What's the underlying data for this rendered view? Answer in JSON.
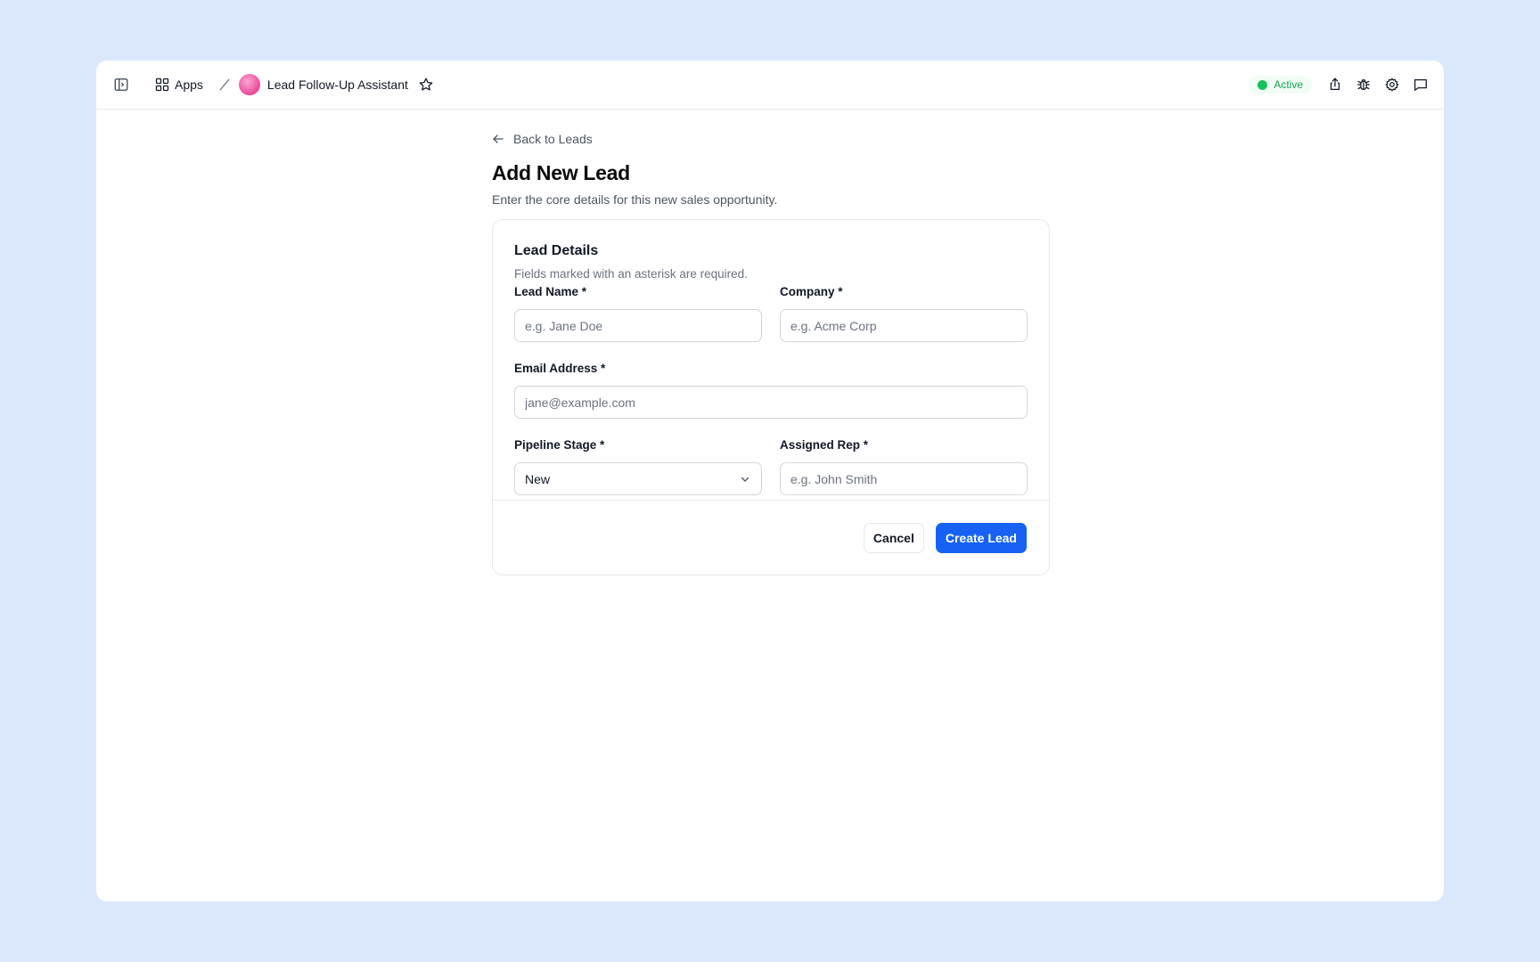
{
  "topbar": {
    "apps_label": "Apps",
    "app_name": "Lead Follow-Up Assistant",
    "status_label": "Active"
  },
  "page": {
    "back_label": "Back to Leads",
    "title": "Add New Lead",
    "subtitle": "Enter the core details for this new sales opportunity."
  },
  "form": {
    "title": "Lead Details",
    "description": "Fields marked with an asterisk are required.",
    "lead_name": {
      "label": "Lead Name *",
      "placeholder": "e.g. Jane Doe",
      "value": ""
    },
    "company": {
      "label": "Company *",
      "placeholder": "e.g. Acme Corp",
      "value": ""
    },
    "email": {
      "label": "Email Address *",
      "placeholder": "jane@example.com",
      "value": ""
    },
    "pipeline_stage": {
      "label": "Pipeline Stage *",
      "value": "New"
    },
    "assigned_rep": {
      "label": "Assigned Rep *",
      "placeholder": "e.g. John Smith",
      "value": ""
    },
    "cancel_label": "Cancel",
    "submit_label": "Create Lead"
  },
  "colors": {
    "background": "#dbe8fb",
    "primary": "#1762f5",
    "status_green": "#16c25a",
    "avatar_pink": "#ec4899"
  },
  "icons": {
    "sidebar_toggle": "sidebar-toggle-icon",
    "apps": "grid-icon",
    "favorite": "star-icon",
    "share": "share-icon",
    "debug": "bug-icon",
    "settings": "gear-icon",
    "chat": "message-icon",
    "back": "arrow-left-icon",
    "select": "chevron-down-icon"
  }
}
